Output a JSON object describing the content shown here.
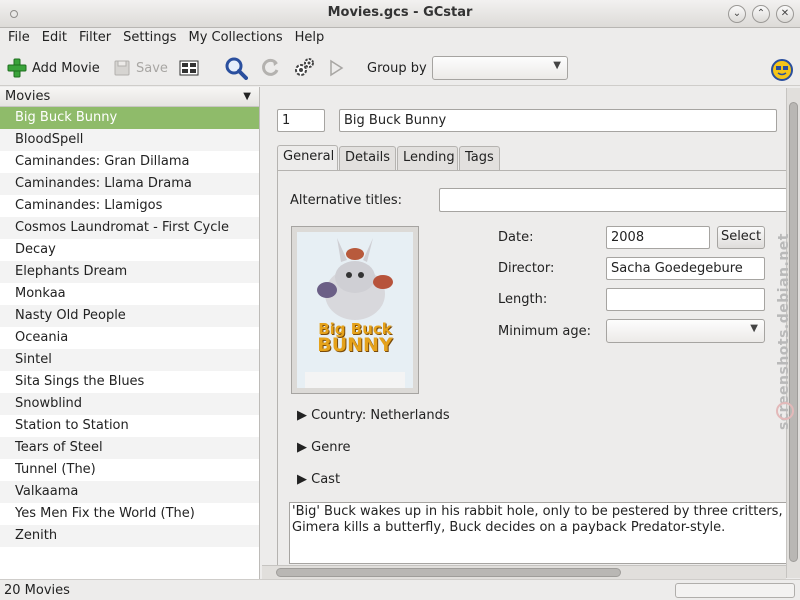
{
  "window": {
    "title": "Movies.gcs - GCstar"
  },
  "menu": [
    "File",
    "Edit",
    "Filter",
    "Settings",
    "My Collections",
    "Help"
  ],
  "toolbar": {
    "add_label": "Add Movie",
    "save_label": "Save",
    "group_by_label": "Group by",
    "group_by_value": ""
  },
  "list": {
    "header": "Movies",
    "items": [
      "Big Buck Bunny",
      "BloodSpell",
      "Caminandes: Gran Dillama",
      "Caminandes: Llama Drama",
      "Caminandes: Llamigos",
      "Cosmos Laundromat - First Cycle",
      "Decay",
      "Elephants Dream",
      "Monkaa",
      "Nasty Old People",
      "Oceania",
      "Sintel",
      "Sita Sings the Blues",
      "Snowblind",
      "Station to Station",
      "Tears of Steel",
      "Tunnel (The)",
      "Valkaama",
      "Yes Men Fix the World (The)",
      "Zenith"
    ],
    "selected_index": 0
  },
  "status": {
    "text": "20 Movies"
  },
  "detail": {
    "id": "1",
    "title": "Big Buck Bunny",
    "tabs": [
      "General",
      "Details",
      "Lending",
      "Tags"
    ],
    "active_tab": 0,
    "alt_titles_label": "Alternative titles:",
    "alt_titles_value": "",
    "date_label": "Date:",
    "date_value": "2008",
    "select_button": "Select",
    "director_label": "Director:",
    "director_value": "Sacha Goedegebure",
    "length_label": "Length:",
    "length_value": "",
    "min_age_label": "Minimum age:",
    "min_age_value": "",
    "poster": {
      "line1": "Big Buck",
      "line2": "BUNNY"
    },
    "country": "Country: Netherlands",
    "genre": "Genre",
    "cast": "Cast",
    "synopsis_line1": "'Big' Buck wakes up in his rabbit hole, only to be pestered by three critters, Gir",
    "synopsis_line2": "Gimera kills a butterfly, Buck decides on a payback Predator-style."
  },
  "watermark": "screenshots.debian.net",
  "colors": {
    "selection": "#8fbb6a",
    "add_icon": "#3aa33a",
    "search_icon": "#2a4f9e"
  }
}
